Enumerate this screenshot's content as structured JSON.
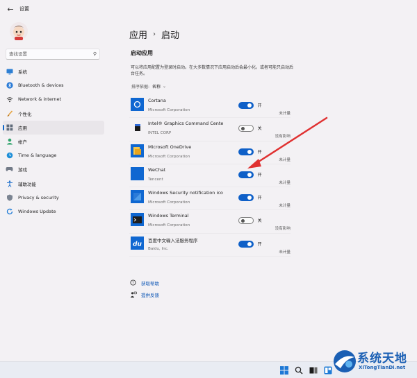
{
  "window": {
    "title": "设置"
  },
  "sidebar": {
    "search": {
      "placeholder": "查找设置"
    },
    "items": [
      {
        "label": "系统",
        "icon": "monitor-icon"
      },
      {
        "label": "Bluetooth & devices",
        "icon": "bluetooth-icon"
      },
      {
        "label": "Network & internet",
        "icon": "wifi-icon"
      },
      {
        "label": "个性化",
        "icon": "brush-icon"
      },
      {
        "label": "应用",
        "icon": "apps-icon",
        "active": true
      },
      {
        "label": "帐户",
        "icon": "person-icon"
      },
      {
        "label": "Time & language",
        "icon": "globe-clock-icon"
      },
      {
        "label": "游戏",
        "icon": "gamepad-icon"
      },
      {
        "label": "辅助功能",
        "icon": "accessibility-icon"
      },
      {
        "label": "Privacy & security",
        "icon": "shield-icon"
      },
      {
        "label": "Windows Update",
        "icon": "update-icon"
      }
    ]
  },
  "main": {
    "breadcrumb": {
      "parent": "应用",
      "separator": "›",
      "current": "启动"
    },
    "section_title": "启动应用",
    "description": "可以将应用配置为登录时启动。在大多数情况下应用启动后会最小化，或者可能只启动后台任务。",
    "sort": {
      "label": "排序依据:",
      "value": "名称"
    },
    "apps": [
      {
        "name": "Cortana",
        "publisher": "Microsoft Corporation",
        "enabled": true,
        "state": "开",
        "impact": "未计量",
        "icon": "cortana-icon"
      },
      {
        "name": "Intel® Graphics Command Center S...",
        "publisher": "INTEL CORP",
        "enabled": false,
        "state": "关",
        "impact": "没有影响",
        "icon": "intel-graphics-icon"
      },
      {
        "name": "Microsoft OneDrive",
        "publisher": "Microsoft Corporation",
        "enabled": true,
        "state": "开",
        "impact": "未计量",
        "icon": "onedrive-icon"
      },
      {
        "name": "WeChat",
        "publisher": "Tencent",
        "enabled": true,
        "state": "开",
        "impact": "未计量",
        "icon": "wechat-icon"
      },
      {
        "name": "Windows Security notification icon",
        "publisher": "Microsoft Corporation",
        "enabled": true,
        "state": "开",
        "impact": "未计量",
        "icon": "windows-security-icon"
      },
      {
        "name": "Windows Terminal",
        "publisher": "Microsoft Corporation",
        "enabled": false,
        "state": "关",
        "impact": "没有影响",
        "icon": "terminal-icon"
      },
      {
        "name": "百度中文输入法服务程序",
        "publisher": "Baidu, Inc.",
        "enabled": true,
        "state": "开",
        "impact": "未计量",
        "icon": "baidu-du-icon"
      }
    ],
    "links": [
      {
        "label": "获取帮助",
        "icon": "help-icon"
      },
      {
        "label": "提供反馈",
        "icon": "feedback-icon"
      }
    ]
  },
  "watermark": {
    "title": "系统天地",
    "subtitle": "XiTongTianDi.net"
  },
  "colors": {
    "accent": "#0f60c8",
    "annotation_arrow": "#e03131",
    "background": "#f3f1f4"
  }
}
